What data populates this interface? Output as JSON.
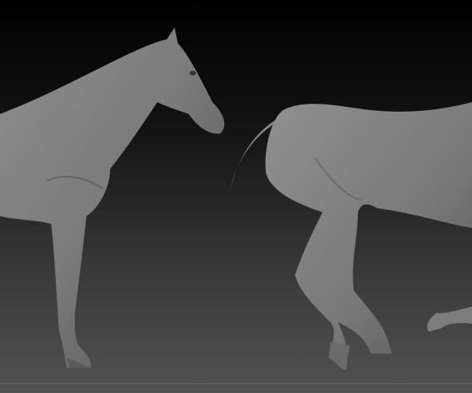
{
  "scene": {
    "subject": "horse-sculpt-render",
    "colors": {
      "background_top": "#000000",
      "background_bottom": "#505050",
      "floor_line": "#6a6a6a",
      "clay_light": "#9a9a9a",
      "clay_mid": "#6e6e6e",
      "clay_dark": "#3a3a3a"
    }
  }
}
